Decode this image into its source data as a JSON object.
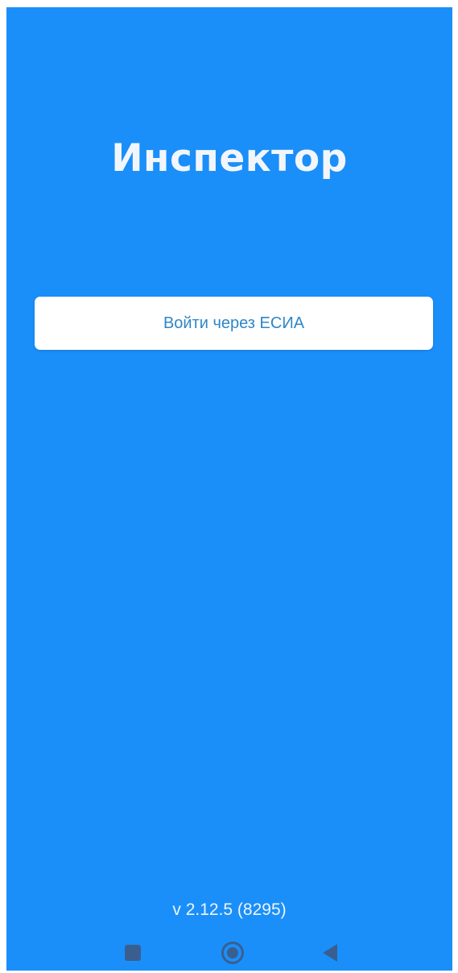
{
  "app": {
    "title": "Инспектор"
  },
  "login": {
    "button_label": "Войти через ЕСИА"
  },
  "footer": {
    "version": "v 2.12.5 (8295)"
  },
  "navbar": {
    "icons": [
      "recent-apps-icon",
      "home-icon",
      "back-icon"
    ]
  },
  "colors": {
    "background": "#1a8ff9",
    "button_bg": "#ffffff",
    "button_text": "#2f86c6",
    "nav_icons": "#3a5f8f"
  }
}
